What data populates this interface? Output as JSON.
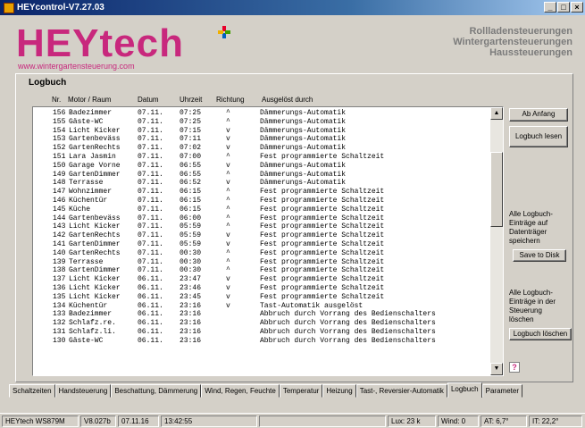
{
  "window": {
    "title": "HEYcontrol-V7.27.03",
    "min": "_",
    "max": "□",
    "close": "×"
  },
  "header": {
    "logo": "HEYtech",
    "url": "www.wintergartensteuerung.com",
    "tagline": [
      "Rollladensteuerungen",
      "Wintergartensteuerungen",
      "Haussteuerungen"
    ]
  },
  "logbook": {
    "title": "Logbuch",
    "columns": {
      "nr": "Nr.",
      "motor": "Motor / Raum",
      "datum": "Datum",
      "uhrzeit": "Uhrzeit",
      "richtung": "Richtung",
      "ausgeloest": "Ausgelöst durch"
    },
    "rows": [
      [
        "156",
        "Badezimmer",
        "07.11.",
        "07:25",
        "^",
        "Dämmerungs-Automatik"
      ],
      [
        "155",
        "Gäste-WC",
        "07.11.",
        "07:25",
        "^",
        "Dämmerungs-Automatik"
      ],
      [
        "154",
        "Licht Kicker",
        "07.11.",
        "07:15",
        "v",
        "Dämmerungs-Automatik"
      ],
      [
        "153",
        "Gartenbeväss",
        "07.11.",
        "07:11",
        "v",
        "Dämmerungs-Automatik"
      ],
      [
        "152",
        "GartenRechts",
        "07.11.",
        "07:02",
        "v",
        "Dämmerungs-Automatik"
      ],
      [
        "151",
        "Lara Jasmin",
        "07.11.",
        "07:00",
        "^",
        "Fest programmierte Schaltzeit"
      ],
      [
        "150",
        "Garage Vorne",
        "07.11.",
        "06:55",
        "v",
        "Dämmerungs-Automatik"
      ],
      [
        "149",
        "GartenDimmer",
        "07.11.",
        "06:55",
        "^",
        "Dämmerungs-Automatik"
      ],
      [
        "148",
        "Terrasse",
        "07.11.",
        "06:52",
        "v",
        "Dämmerungs-Automatik"
      ],
      [
        "147",
        "Wohnzimmer",
        "07.11.",
        "06:15",
        "^",
        "Fest programmierte Schaltzeit"
      ],
      [
        "146",
        "Küchentür",
        "07.11.",
        "06:15",
        "^",
        "Fest programmierte Schaltzeit"
      ],
      [
        "145",
        "Küche",
        "07.11.",
        "06:15",
        "^",
        "Fest programmierte Schaltzeit"
      ],
      [
        "144",
        "Gartenbeväss",
        "07.11.",
        "06:00",
        "^",
        "Fest programmierte Schaltzeit"
      ],
      [
        "143",
        "Licht Kicker",
        "07.11.",
        "05:59",
        "^",
        "Fest programmierte Schaltzeit"
      ],
      [
        "142",
        "GartenRechts",
        "07.11.",
        "05:59",
        "v",
        "Fest programmierte Schaltzeit"
      ],
      [
        "141",
        "GartenDimmer",
        "07.11.",
        "05:59",
        "v",
        "Fest programmierte Schaltzeit"
      ],
      [
        "140",
        "GartenRechts",
        "07.11.",
        "00:30",
        "^",
        "Fest programmierte Schaltzeit"
      ],
      [
        "139",
        "Terrasse",
        "07.11.",
        "00:30",
        "^",
        "Fest programmierte Schaltzeit"
      ],
      [
        "138",
        "GartenDimmer",
        "07.11.",
        "00:30",
        "^",
        "Fest programmierte Schaltzeit"
      ],
      [
        "137",
        "Licht Kicker",
        "06.11.",
        "23:47",
        "v",
        "Fest programmierte Schaltzeit"
      ],
      [
        "136",
        "Licht Kicker",
        "06.11.",
        "23:46",
        "v",
        "Fest programmierte Schaltzeit"
      ],
      [
        "135",
        "Licht Kicker",
        "06.11.",
        "23:45",
        "v",
        "Fest programmierte Schaltzeit"
      ],
      [
        "134",
        "Küchentür",
        "06.11.",
        "23:16",
        "v",
        "Tast-Automatik ausgelöst"
      ],
      [
        "133",
        "Badezimmer",
        "06.11.",
        "23:16",
        "",
        "Abbruch durch Vorrang des Bedienschalters"
      ],
      [
        "132",
        "Schlafz.re.",
        "06.11.",
        "23:16",
        "",
        "Abbruch durch Vorrang des Bedienschalters"
      ],
      [
        "131",
        "Schlafz.li.",
        "06.11.",
        "23:16",
        "",
        "Abbruch durch Vorrang des Bedienschalters"
      ],
      [
        "130",
        "Gäste-WC",
        "06.11.",
        "23:16",
        "",
        "Abbruch durch Vorrang des Bedienschalters"
      ]
    ]
  },
  "side": {
    "ab_anfang": "Ab Anfang",
    "logbuch_lesen": "Logbuch lesen",
    "save_text": [
      "Alle Logbuch-",
      "Einträge auf",
      "Datenträger",
      "speichern"
    ],
    "save_to_disk": "Save to Disk",
    "delete_text": [
      "Alle Logbuch-",
      "Einträge in der",
      "Steuerung",
      "löschen"
    ],
    "logbuch_loeschen": "Logbuch löschen",
    "help": "?"
  },
  "tabs": [
    "Schaltzeiten",
    "Handsteuerung",
    "Beschattung, Dämmerung",
    "Wind, Regen, Feuchte",
    "Temperatur",
    "Heizung",
    "Tast-, Reversier-Automatik",
    "Logbuch",
    "Parameter"
  ],
  "active_tab": "Logbuch",
  "status": {
    "device": "HEYtech WS879M",
    "version": "V8.027b",
    "date": "07.11.16",
    "time": "13:42:55",
    "lux": "Lux:  23 k",
    "wind": "Wind:  0",
    "at": "AT: 6,7°",
    "it": "IT: 22,2°"
  },
  "colors": {
    "brand": "#c8287d",
    "face": "#d4d0c8",
    "title_start": "#0a246a"
  }
}
